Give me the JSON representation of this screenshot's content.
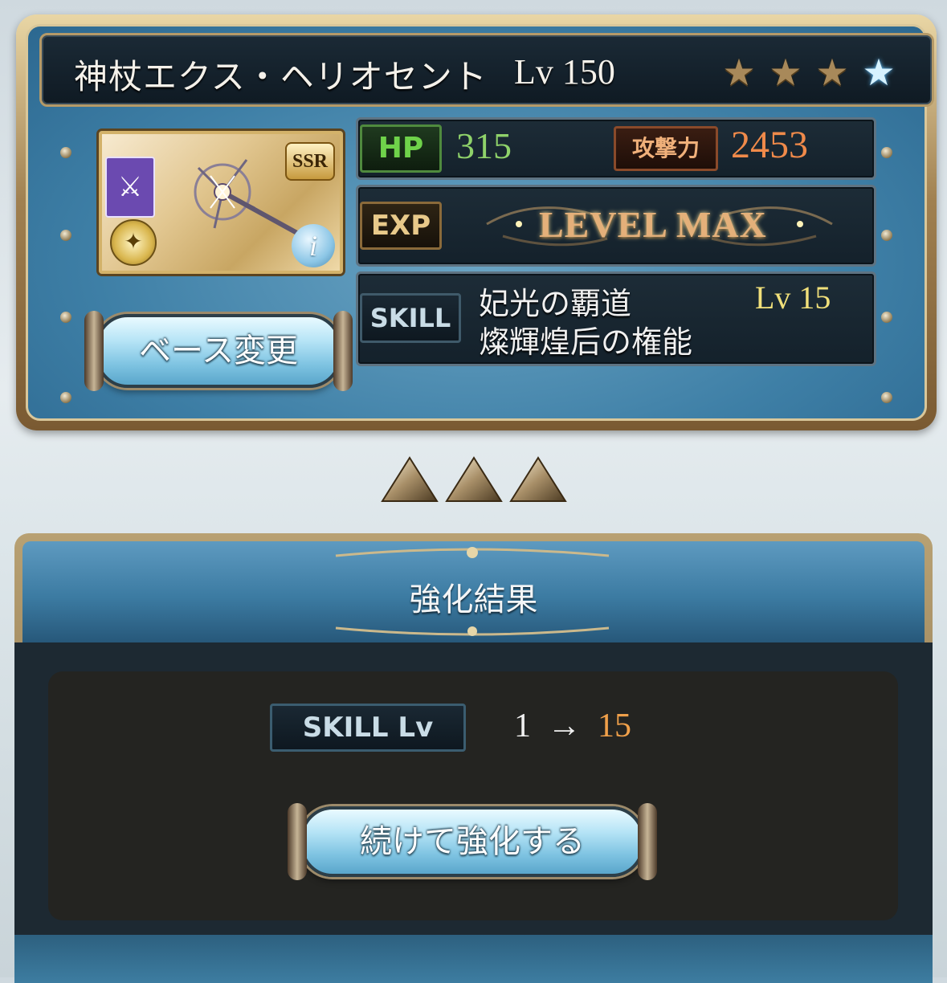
{
  "weapon": {
    "name": "神杖エクス・ヘリオセント",
    "level_label": "Lv 150",
    "stars": [
      "gold-star",
      "gold-star",
      "gold-star",
      "blue-star"
    ],
    "rarity": "SSR",
    "hp_label": "HP",
    "hp_value": "315",
    "atk_label": "攻撃力",
    "atk_value": "2453",
    "exp_label": "EXP",
    "exp_status": "LEVEL MAX",
    "skill_label": "SKILL",
    "skill_names": [
      "妃光の覇道",
      "燦輝煌后の権能"
    ],
    "skill_level": "Lv 15",
    "base_change_button": "ベース変更"
  },
  "result": {
    "title": "強化結果",
    "skill_lv_label": "SKILL Lv",
    "from": "1",
    "arrow": "→",
    "to": "15",
    "continue_button": "続けて強化する"
  },
  "colors": {
    "hp_value": "#8fd26a",
    "atk_value": "#f08a4a",
    "skill_level": "#f1e07a",
    "result_to": "#f0a04a"
  }
}
